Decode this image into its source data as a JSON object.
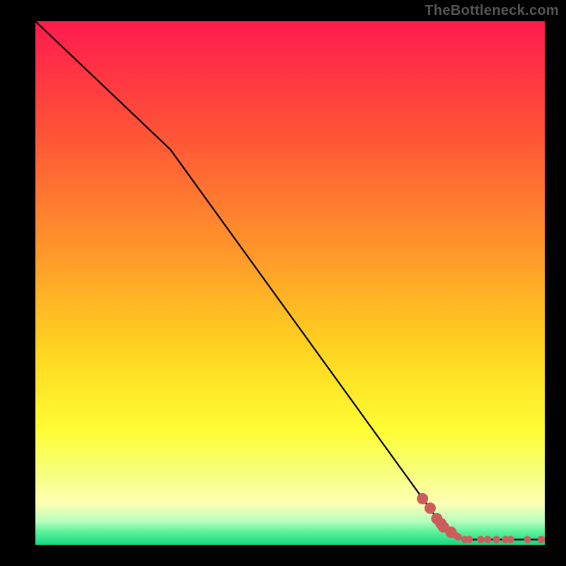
{
  "attribution": "TheBottleneck.com",
  "chart_data": {
    "type": "line",
    "title": "",
    "xlabel": "",
    "ylabel": "",
    "xlim": [
      0,
      100
    ],
    "ylim": [
      0,
      100
    ],
    "gradient_stops": [
      {
        "offset": 0.0,
        "color": "#ff1a4e"
      },
      {
        "offset": 0.22,
        "color": "#ff5536"
      },
      {
        "offset": 0.45,
        "color": "#ff9a2a"
      },
      {
        "offset": 0.62,
        "color": "#ffd21f"
      },
      {
        "offset": 0.78,
        "color": "#fffd33"
      },
      {
        "offset": 0.86,
        "color": "#f6ff7a"
      },
      {
        "offset": 0.92,
        "color": "#ffffb4"
      },
      {
        "offset": 0.955,
        "color": "#b8ffbd"
      },
      {
        "offset": 0.975,
        "color": "#5ef19c"
      },
      {
        "offset": 1.0,
        "color": "#17d884"
      }
    ],
    "series": [
      {
        "name": "bottleneck-curve",
        "x": [
          0,
          26.5,
          78.5,
          84,
          100
        ],
        "y": [
          100,
          75.5,
          5.5,
          1.0,
          1.0
        ],
        "segment_kind": [
          "line",
          "line",
          "line",
          "line"
        ],
        "note": "black polyline; first knee around x≈26, floors to ~1 at x≈84"
      }
    ],
    "markers": {
      "name": "data-points",
      "color": "#cd5c5c",
      "points": [
        {
          "x": 76.0,
          "y": 8.8,
          "size": "lg"
        },
        {
          "x": 77.5,
          "y": 7.0,
          "size": "lg"
        },
        {
          "x": 78.8,
          "y": 5.0,
          "size": "lg"
        },
        {
          "x": 79.6,
          "y": 4.1,
          "size": "lg"
        },
        {
          "x": 80.1,
          "y": 3.4,
          "size": "lg"
        },
        {
          "x": 81.6,
          "y": 2.4,
          "size": "lg"
        },
        {
          "x": 82.5,
          "y": 1.8,
          "size": "sm"
        },
        {
          "x": 83.0,
          "y": 1.5,
          "size": "sm"
        },
        {
          "x": 84.3,
          "y": 1.0,
          "size": "sm"
        },
        {
          "x": 85.2,
          "y": 1.0,
          "size": "sm"
        },
        {
          "x": 87.4,
          "y": 1.0,
          "size": "sm"
        },
        {
          "x": 88.8,
          "y": 1.0,
          "size": "sm"
        },
        {
          "x": 90.5,
          "y": 1.0,
          "size": "sm"
        },
        {
          "x": 92.3,
          "y": 1.0,
          "size": "sm"
        },
        {
          "x": 93.3,
          "y": 1.0,
          "size": "sm"
        },
        {
          "x": 96.6,
          "y": 1.0,
          "size": "sm"
        },
        {
          "x": 99.3,
          "y": 1.0,
          "size": "sm"
        }
      ]
    }
  }
}
